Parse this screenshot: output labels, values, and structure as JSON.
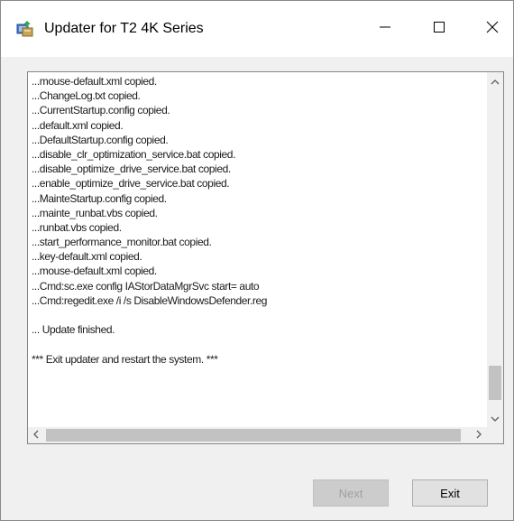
{
  "window": {
    "title": "Updater for T2 4K Series"
  },
  "log": {
    "lines": [
      "...mouse-default.xml copied.",
      "...ChangeLog.txt copied.",
      "...CurrentStartup.config copied.",
      "...default.xml copied.",
      "...DefaultStartup.config copied.",
      "...disable_clr_optimization_service.bat copied.",
      "...disable_optimize_drive_service.bat copied.",
      "...enable_optimize_drive_service.bat copied.",
      "...MainteStartup.config copied.",
      "...mainte_runbat.vbs copied.",
      "...runbat.vbs copied.",
      "...start_performance_monitor.bat copied.",
      "...key-default.xml copied.",
      "...mouse-default.xml copied.",
      "...Cmd:sc.exe config IAStorDataMgrSvc start= auto",
      "...Cmd:regedit.exe /i /s DisableWindowsDefender.reg",
      "",
      "... Update finished.",
      "",
      "*** Exit updater and restart the system. ***"
    ]
  },
  "buttons": {
    "next_label": "Next",
    "exit_label": "Exit"
  },
  "scrollbar": {
    "vertical_position": 0.92,
    "horizontal_position": 0.0
  },
  "colors": {
    "disabled_button_bg": "#cccccc",
    "button_bg": "#e1e1e1",
    "scroll_thumb": "#c2c2c2"
  }
}
